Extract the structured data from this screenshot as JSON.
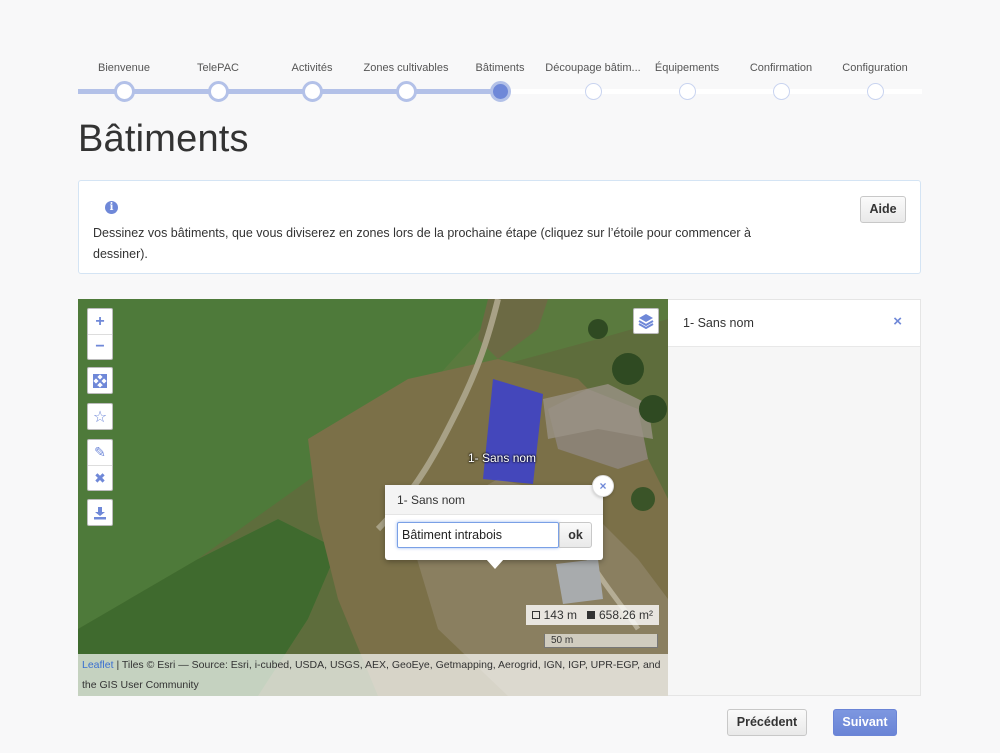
{
  "stepper": {
    "steps": [
      {
        "label": "Bienvenue",
        "state": "done"
      },
      {
        "label": "TelePAC",
        "state": "done"
      },
      {
        "label": "Activités",
        "state": "done"
      },
      {
        "label": "Zones cultivables",
        "state": "done"
      },
      {
        "label": "Bâtiments",
        "state": "current"
      },
      {
        "label": "Découpage bâtim...",
        "state": "todo"
      },
      {
        "label": "Équipements",
        "state": "todo"
      },
      {
        "label": "Confirmation",
        "state": "todo"
      },
      {
        "label": "Configuration",
        "state": "todo"
      }
    ]
  },
  "page": {
    "title": "Bâtiments"
  },
  "info": {
    "icon": "info-icon",
    "message": "Dessinez vos bâtiments, que vous diviserez en zones lors de la prochaine étape (cliquez sur l’étoile pour commencer à dessiner).",
    "help_label": "Aide"
  },
  "map": {
    "controls": {
      "zoom_in": "+",
      "zoom_out": "−",
      "fullscreen_icon": "expand-icon",
      "star_icon": "star-icon",
      "edit_icon": "pencil-icon",
      "delete_icon": "close-icon",
      "download_icon": "download-icon",
      "layers_icon": "layers-icon"
    },
    "polygon_label": "1- Sans nom",
    "popup": {
      "title": "1- Sans nom",
      "input_value": "Bâtiment intrabois",
      "ok_label": "ok",
      "close_label": "×"
    },
    "measure": {
      "perimeter": "143 m",
      "area": "658.26 m²"
    },
    "scale_label": "50 m",
    "attribution": {
      "link": "Leaflet",
      "text": " | Tiles © Esri — Source: Esri, i-cubed, USDA, USGS, AEX, GeoEye, Getmapping, Aerogrid, IGN, IGP, UPR-EGP, and the GIS User Community"
    },
    "polygon_color": "#3b3fd0"
  },
  "side_panel": {
    "items": [
      {
        "name": "1- Sans nom",
        "remove": "×"
      }
    ]
  },
  "nav": {
    "prev_label": "Précédent",
    "next_label": "Suivant"
  },
  "colors": {
    "accent": "#6f88d8",
    "track_done": "#b3c1e8"
  }
}
